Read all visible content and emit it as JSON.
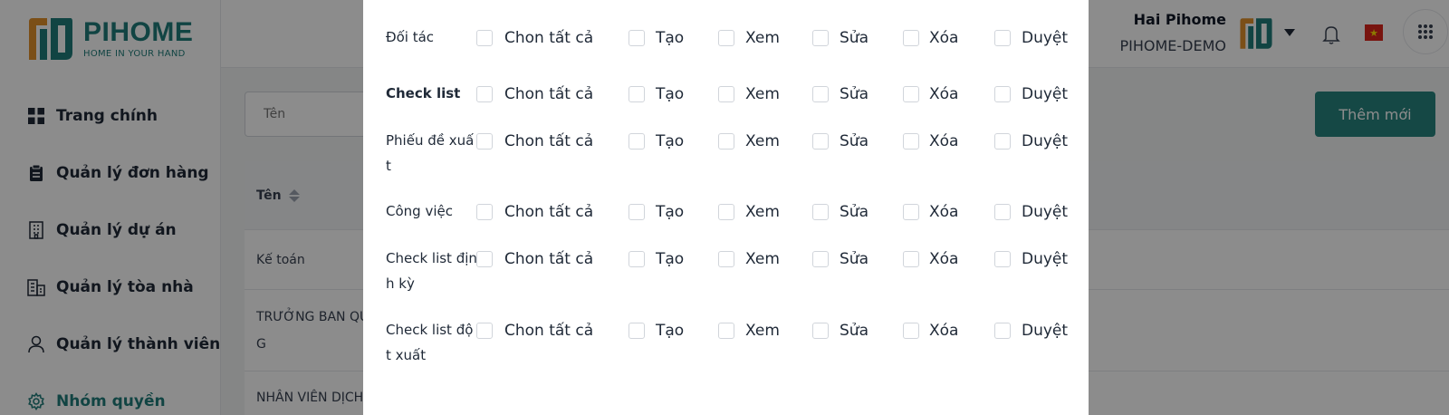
{
  "brand": {
    "name": "PIHOME",
    "tagline": "HOME IN YOUR HAND",
    "accent": "#1f7d7a",
    "orange": "#e0902a"
  },
  "sidebar": {
    "items": [
      {
        "label": "Trang chính",
        "icon": "dashboard-icon"
      },
      {
        "label": "Quản lý đơn hàng",
        "icon": "clipboard-icon"
      },
      {
        "label": "Quản lý dự án",
        "icon": "building-icon"
      },
      {
        "label": "Quản lý tòa nhà",
        "icon": "buildings-icon"
      },
      {
        "label": "Quản lý thành viên",
        "icon": "user-icon"
      },
      {
        "label": "Nhóm quyền",
        "icon": "gear-icon",
        "active": true
      }
    ]
  },
  "header": {
    "user_name": "Hai Pihome",
    "org": "PIHOME-DEMO"
  },
  "main": {
    "search_placeholder": "Tên",
    "add_label": "Thêm mới",
    "column_name": "Tên",
    "rows": [
      "Kế toán",
      "TRƯỞNG BAN QU\nG",
      "NHÂN VIÊN DỊCH"
    ]
  },
  "modal": {
    "options": [
      "Chon tất cả",
      "Tạo",
      "Xem",
      "Sửa",
      "Xóa",
      "Duyệt"
    ],
    "permissions": [
      {
        "label": "Đối tác",
        "bold": false
      },
      {
        "label": "Check list",
        "bold": true
      },
      {
        "label": "Phiếu đề xuất",
        "bold": false
      },
      {
        "label": "Công việc",
        "bold": false
      },
      {
        "label": "Check list định kỳ",
        "bold": false
      },
      {
        "label": "Check list đột xuất",
        "bold": false
      }
    ]
  }
}
